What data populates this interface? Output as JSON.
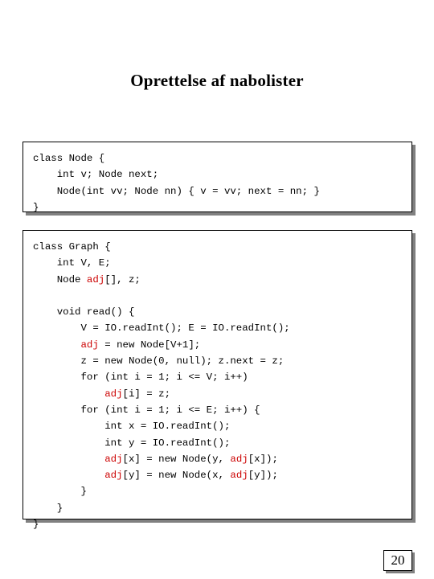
{
  "slide": {
    "title": "Oprettelse af nabolister",
    "page_number": "20"
  },
  "code_blocks": [
    {
      "id": "node-class",
      "lines": [
        {
          "segments": [
            {
              "text": "class Node {",
              "style": "plain"
            }
          ]
        },
        {
          "segments": [
            {
              "text": "    int v; Node next;",
              "style": "plain"
            }
          ]
        },
        {
          "segments": [
            {
              "text": "    Node(int vv; Node nn) { v = vv; next = nn; }",
              "style": "plain"
            }
          ]
        },
        {
          "segments": [
            {
              "text": "}",
              "style": "plain"
            }
          ]
        }
      ]
    },
    {
      "id": "graph-class",
      "lines": [
        {
          "segments": [
            {
              "text": "class Graph {",
              "style": "plain"
            }
          ]
        },
        {
          "segments": [
            {
              "text": "    int V, E;",
              "style": "plain"
            }
          ]
        },
        {
          "segments": [
            {
              "text": "    Node ",
              "style": "plain"
            },
            {
              "text": "adj",
              "style": "highlight"
            },
            {
              "text": "[], z;",
              "style": "plain"
            }
          ]
        },
        {
          "segments": [
            {
              "text": "",
              "style": "plain"
            }
          ]
        },
        {
          "segments": [
            {
              "text": "    void read() {",
              "style": "plain"
            }
          ]
        },
        {
          "segments": [
            {
              "text": "        V = IO.readInt(); E = IO.readInt();",
              "style": "plain"
            }
          ]
        },
        {
          "segments": [
            {
              "text": "        ",
              "style": "plain"
            },
            {
              "text": "adj",
              "style": "highlight"
            },
            {
              "text": " = new Node[V+1];",
              "style": "plain"
            }
          ]
        },
        {
          "segments": [
            {
              "text": "        z = new Node(0, null); z.next = z;",
              "style": "plain"
            }
          ]
        },
        {
          "segments": [
            {
              "text": "        for (int i = 1; i <= V; i++)",
              "style": "plain"
            }
          ]
        },
        {
          "segments": [
            {
              "text": "            ",
              "style": "plain"
            },
            {
              "text": "adj",
              "style": "highlight"
            },
            {
              "text": "[i] = z;",
              "style": "plain"
            }
          ]
        },
        {
          "segments": [
            {
              "text": "        for (int i = 1; i <= E; i++) {",
              "style": "plain"
            }
          ]
        },
        {
          "segments": [
            {
              "text": "            int x = IO.readInt();",
              "style": "plain"
            }
          ]
        },
        {
          "segments": [
            {
              "text": "            int y = IO.readInt();",
              "style": "plain"
            }
          ]
        },
        {
          "segments": [
            {
              "text": "            ",
              "style": "plain"
            },
            {
              "text": "adj",
              "style": "highlight"
            },
            {
              "text": "[x] = new Node(y, ",
              "style": "plain"
            },
            {
              "text": "adj",
              "style": "highlight"
            },
            {
              "text": "[x]);",
              "style": "plain"
            }
          ]
        },
        {
          "segments": [
            {
              "text": "            ",
              "style": "plain"
            },
            {
              "text": "adj",
              "style": "highlight"
            },
            {
              "text": "[y] = new Node(x, ",
              "style": "plain"
            },
            {
              "text": "adj",
              "style": "highlight"
            },
            {
              "text": "[y]);",
              "style": "plain"
            }
          ]
        },
        {
          "segments": [
            {
              "text": "        }",
              "style": "plain"
            }
          ]
        },
        {
          "segments": [
            {
              "text": "    }",
              "style": "plain"
            }
          ]
        },
        {
          "segments": [
            {
              "text": "}",
              "style": "plain"
            }
          ]
        }
      ]
    }
  ],
  "colors": {
    "highlight": "#cc0000",
    "text": "#000000",
    "shadow": "#808080",
    "background": "#ffffff"
  }
}
